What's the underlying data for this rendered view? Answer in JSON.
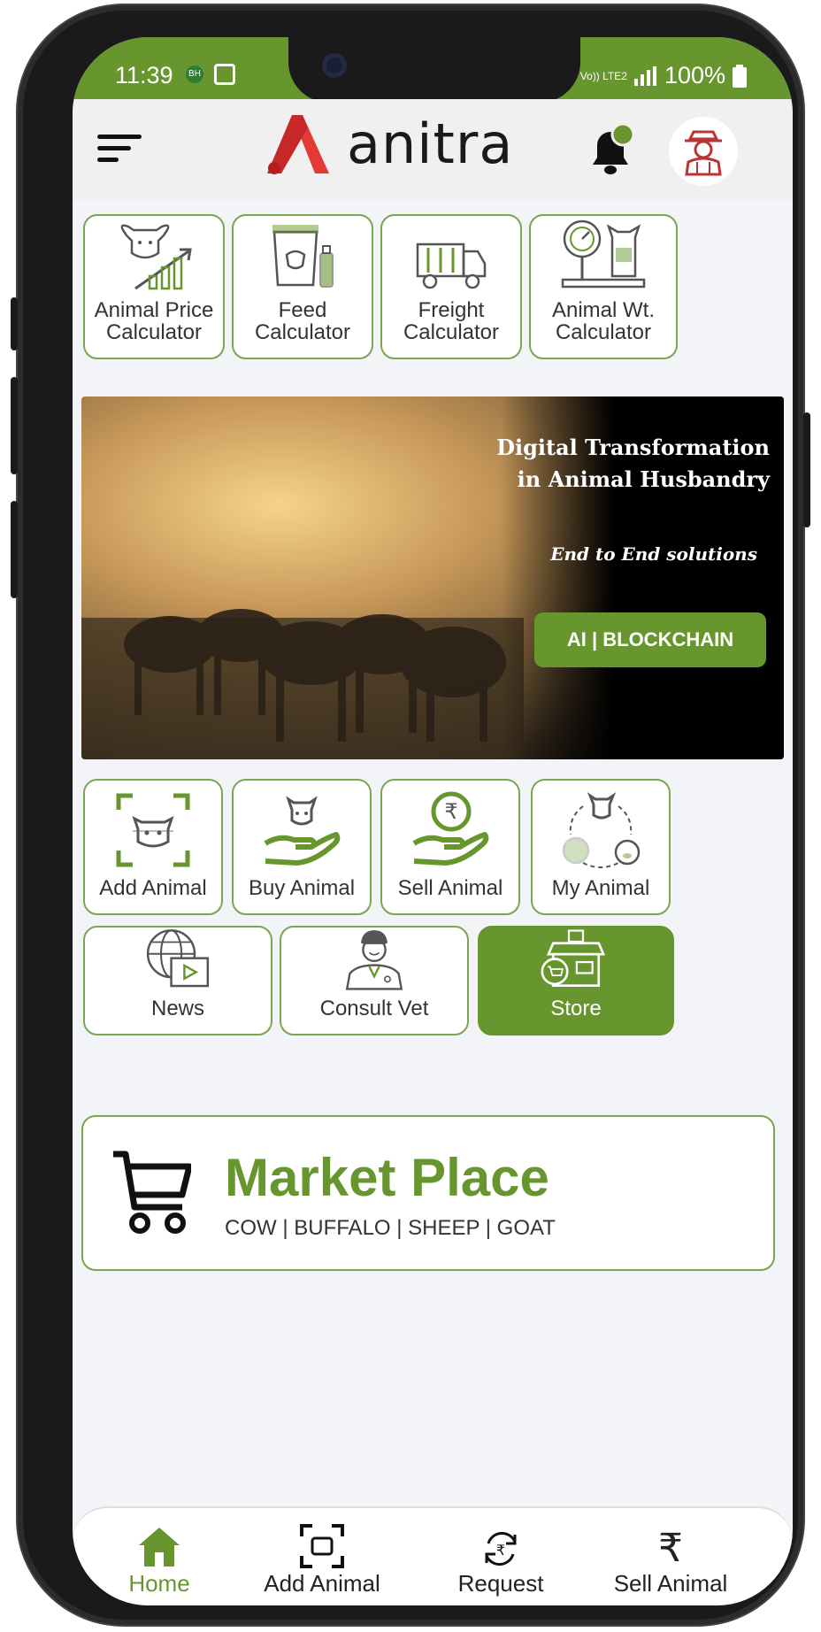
{
  "status": {
    "time": "11:39",
    "battery": "100%",
    "network": "Vo)) LTE2"
  },
  "header": {
    "logo_text": "anitra"
  },
  "calculators": [
    {
      "label": "Animal Price Calculator",
      "icon": "bull-growth-icon"
    },
    {
      "label": "Feed Calculator",
      "icon": "feed-bucket-icon"
    },
    {
      "label": "Freight Calculator",
      "icon": "truck-icon"
    },
    {
      "label": "Animal Wt. Calculator",
      "icon": "scale-cow-icon"
    }
  ],
  "banner": {
    "title_line1": "Digital Transformation",
    "title_line2": "in Animal Husbandry",
    "subtitle": "End to End solutions",
    "button": "AI | BLOCKCHAIN"
  },
  "actions": [
    {
      "label": "Add Animal"
    },
    {
      "label": "Buy Animal"
    },
    {
      "label": "Sell Animal"
    },
    {
      "label": "My Animal"
    }
  ],
  "services": [
    {
      "label": "News"
    },
    {
      "label": "Consult Vet"
    },
    {
      "label": "Store"
    }
  ],
  "market": {
    "title": "Market Place",
    "subtitle": "COW | BUFFALO | SHEEP | GOAT"
  },
  "bottom_nav": [
    {
      "label": "Home"
    },
    {
      "label": "Add Animal"
    },
    {
      "label": "Request"
    },
    {
      "label": "Sell Animal"
    }
  ],
  "colors": {
    "brand_green": "#67962e",
    "border_green": "#7aa552",
    "logo_red": "#d62828"
  }
}
